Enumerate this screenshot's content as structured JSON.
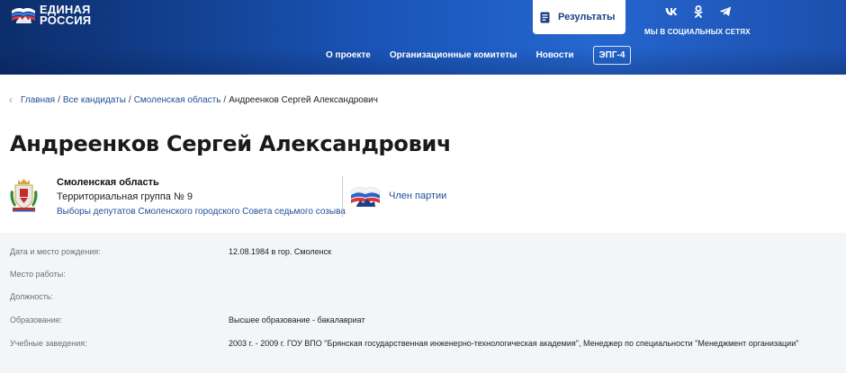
{
  "header": {
    "logo": {
      "line1": "ЕДИНАЯ",
      "line2": "РОССИЯ"
    },
    "results_button": "Результаты",
    "social": {
      "icons": [
        "vk-icon",
        "odnoklassniki-icon",
        "telegram-icon"
      ],
      "caption": "МЫ В СОЦИАЛЬНЫХ СЕТЯХ"
    },
    "nav": [
      {
        "label": "О проекте"
      },
      {
        "label": "Организационные комитеты"
      },
      {
        "label": "Новости"
      },
      {
        "label": "ЭПГ-4"
      }
    ]
  },
  "breadcrumb": {
    "items": [
      "Главная",
      "Все кандидаты",
      "Смоленская область"
    ],
    "current": "Андреенков Сергей Александрович"
  },
  "page_title": "Андреенков Сергей Александрович",
  "candidate": {
    "region": "Смоленская область",
    "group": "Территориальная группа № 9",
    "election": "Выборы депутатов Смоленского городского Совета седьмого созыва",
    "party_status": "Член партии"
  },
  "details": [
    {
      "label": "Дата и место рождения:",
      "value": "12.08.1984 в гор. Смоленск"
    },
    {
      "label": "Место работы:",
      "value": ""
    },
    {
      "label": "Должность:",
      "value": ""
    },
    {
      "label": "Образование:",
      "value": "Высшее образование - бакалавриат"
    },
    {
      "label": "Учебные заведения:",
      "value": "2003 г. - 2009 г. ГОУ ВПО \"Брянская государственная инженерно-технологическая академия\", Менеджер по специальности \"Менеджмент организации\""
    }
  ],
  "colors": {
    "header_dark": "#0c2d6b",
    "header_light": "#2566cf",
    "link": "#1d4e9a",
    "details_bg": "#f4f5f7"
  }
}
